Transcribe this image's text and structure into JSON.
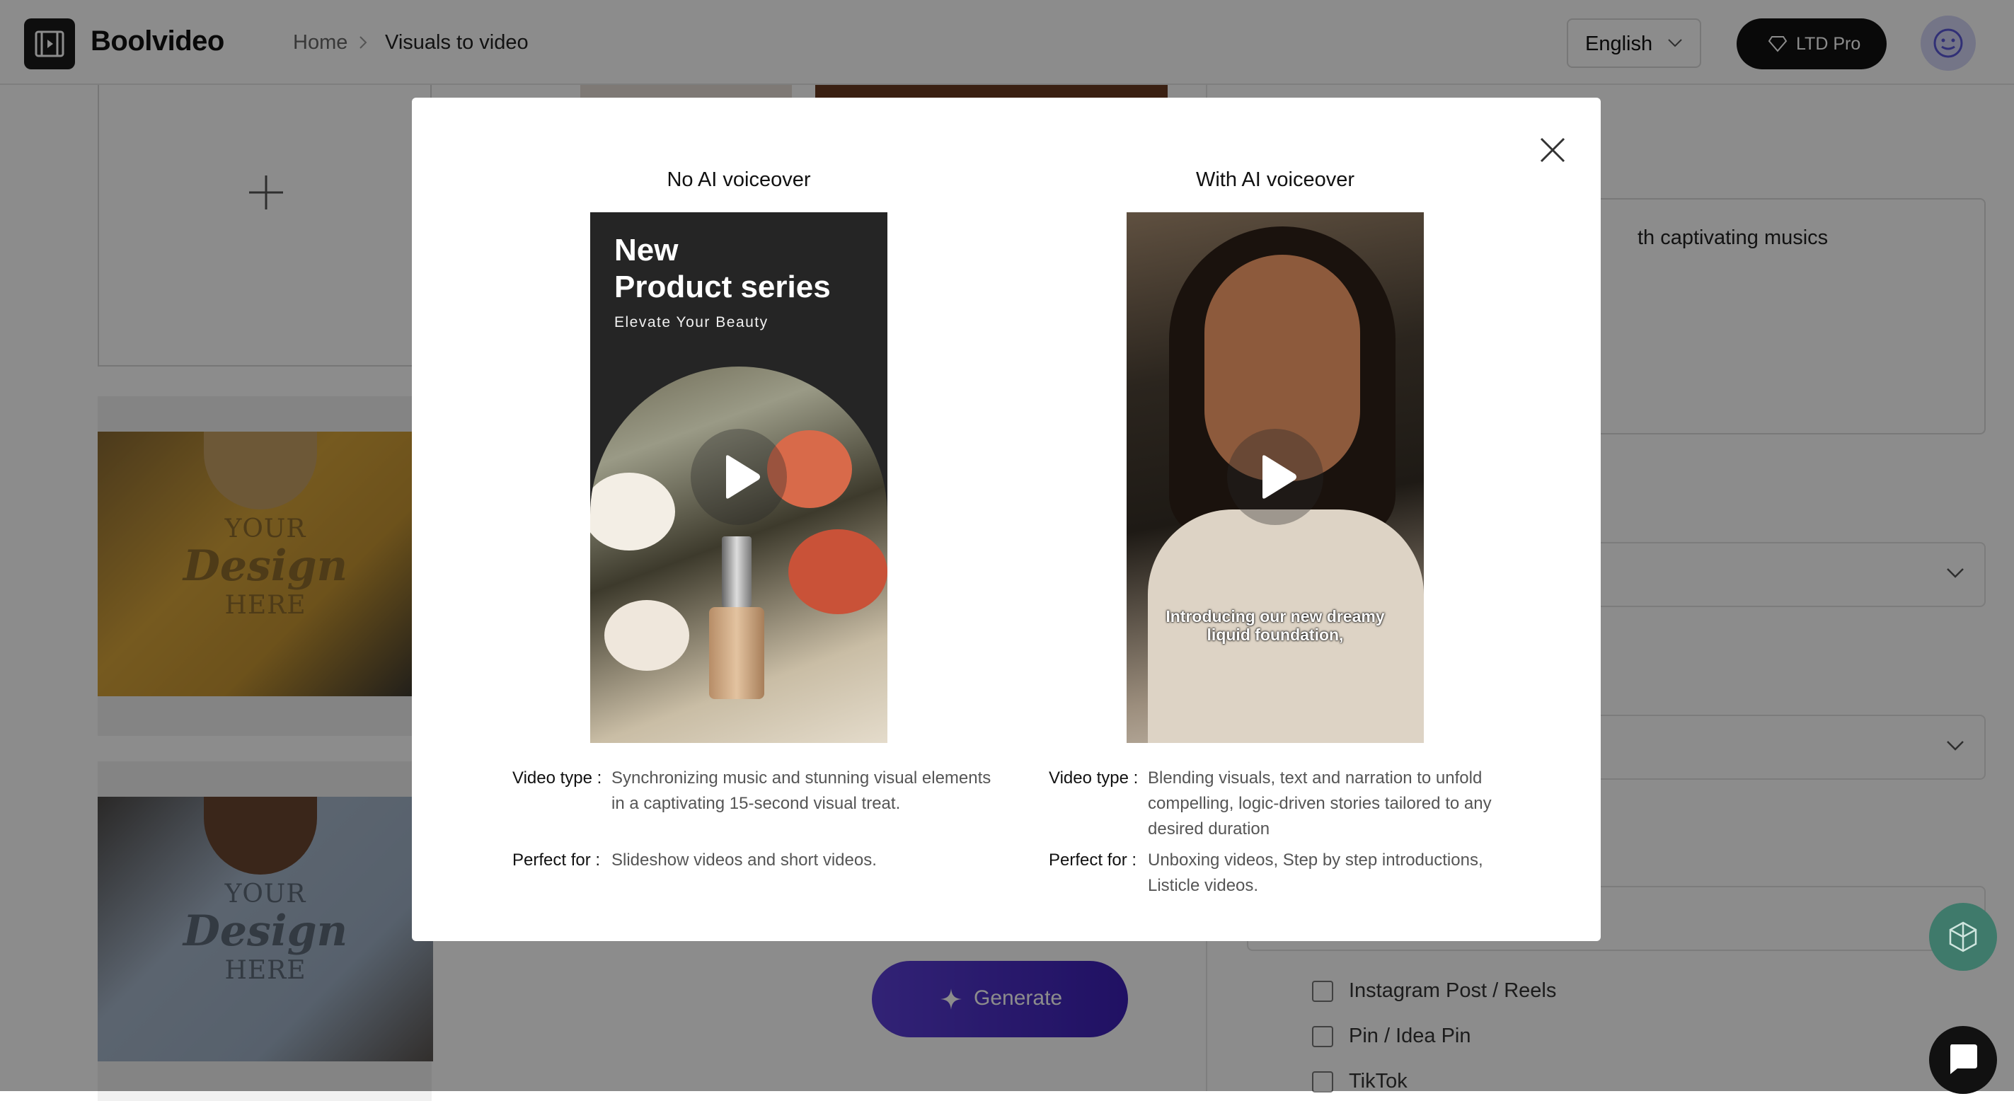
{
  "header": {
    "brand": "Boolvideo",
    "breadcrumb": {
      "home": "Home",
      "current": "Visuals to video"
    },
    "language": "English",
    "pro_label": "LTD Pro",
    "icons": {
      "logo": "film-logo-icon",
      "breadcrumb_sep": "chevron-right-icon",
      "lang_caret": "chevron-down-icon",
      "pro": "diamond-icon",
      "avatar": "smiley-icon"
    }
  },
  "background": {
    "uploads": {
      "add_icon": "plus-icon",
      "tshirt_print": {
        "line1": "YOUR",
        "line2": "Design",
        "line3": "HERE"
      }
    },
    "prompt_text": "th captivating musics",
    "generate_label": "Generate",
    "platforms": [
      "Instagram Post / Reels",
      "Pin / Idea Pin",
      "TikTok"
    ]
  },
  "modal": {
    "options": [
      {
        "title": "No AI voiceover",
        "preview": {
          "heading_line1": "New",
          "heading_line2": "Product series",
          "subheading": "Elevate Your Beauty"
        },
        "video_type_key": "Video type :",
        "video_type_value": "Synchronizing music and stunning visual elements in a captivating 15-second visual treat.",
        "perfect_for_key": "Perfect for :",
        "perfect_for_value": "Slideshow videos and short videos."
      },
      {
        "title": "With AI voiceover",
        "preview": {
          "caption": "Introducing our new dreamy liquid foundation,"
        },
        "video_type_key": "Video type :",
        "video_type_value": "Blending visuals, text and narration to unfold compelling, logic-driven stories tailored to any desired duration",
        "perfect_for_key": "Perfect for :",
        "perfect_for_value": "Unboxing videos, Step by step introductions, Listicle videos."
      }
    ]
  },
  "colors": {
    "accent_gradient_start": "#5b3fd6",
    "accent_gradient_end": "#3b1fb5",
    "pro_button": "#111111",
    "avatar_bg": "#d3d5f6",
    "float_btn": "#3f7a6b"
  }
}
